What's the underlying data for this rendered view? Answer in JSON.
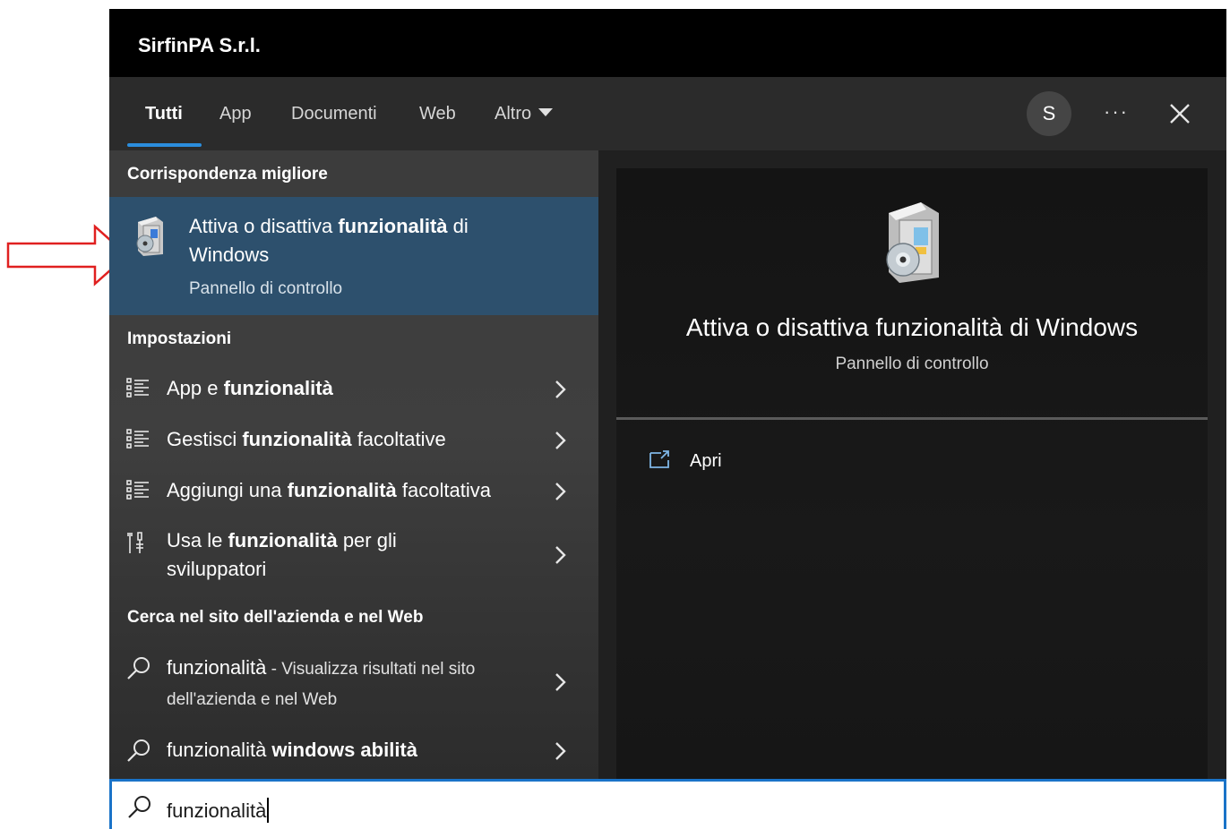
{
  "window": {
    "title": "SirfinPA S.r.l."
  },
  "tabs": [
    {
      "label": "Tutti",
      "active": true
    },
    {
      "label": "App"
    },
    {
      "label": "Documenti"
    },
    {
      "label": "Web"
    },
    {
      "label": "Altro"
    }
  ],
  "header": {
    "avatar_letter": "S",
    "more_label": "···"
  },
  "best_match": {
    "section_title": "Corrispondenza migliore",
    "title_pre": "Attiva o disattiva ",
    "title_bold": "funzionalità",
    "title_post": " di",
    "title_line2": "Windows",
    "subtitle": "Pannello di controllo"
  },
  "settings": {
    "section_title": "Impostazioni",
    "items": [
      {
        "pre": "App e ",
        "bold": "funzionalità",
        "post": ""
      },
      {
        "pre": "Gestisci ",
        "bold": "funzionalità",
        "post": " facoltative"
      },
      {
        "pre": "Aggiungi una ",
        "bold": "funzionalità",
        "post": " facoltativa"
      },
      {
        "pre": "Usa le ",
        "bold": "funzionalità",
        "post": " per gli",
        "line2": "sviluppatori"
      }
    ]
  },
  "web": {
    "section_title": "Cerca nel sito dell'azienda e nel Web",
    "items": [
      {
        "pre": "funzionalità",
        "small": " - Visualizza risultati nel sito",
        "line2": "dell'azienda e nel Web"
      },
      {
        "pre": "funzionalità ",
        "bold": "windows abilità"
      }
    ]
  },
  "preview": {
    "title": "Attiva o disattiva funzionalità di Windows",
    "subtitle": "Pannello di controllo",
    "actions": [
      {
        "label": "Apri",
        "icon": "open-icon"
      }
    ]
  },
  "search": {
    "value": "funzionalità",
    "icon": "search-icon"
  },
  "colors": {
    "accent": "#2b8ddd",
    "selected_bg": "#2d506d",
    "annotation": "#e02020"
  }
}
